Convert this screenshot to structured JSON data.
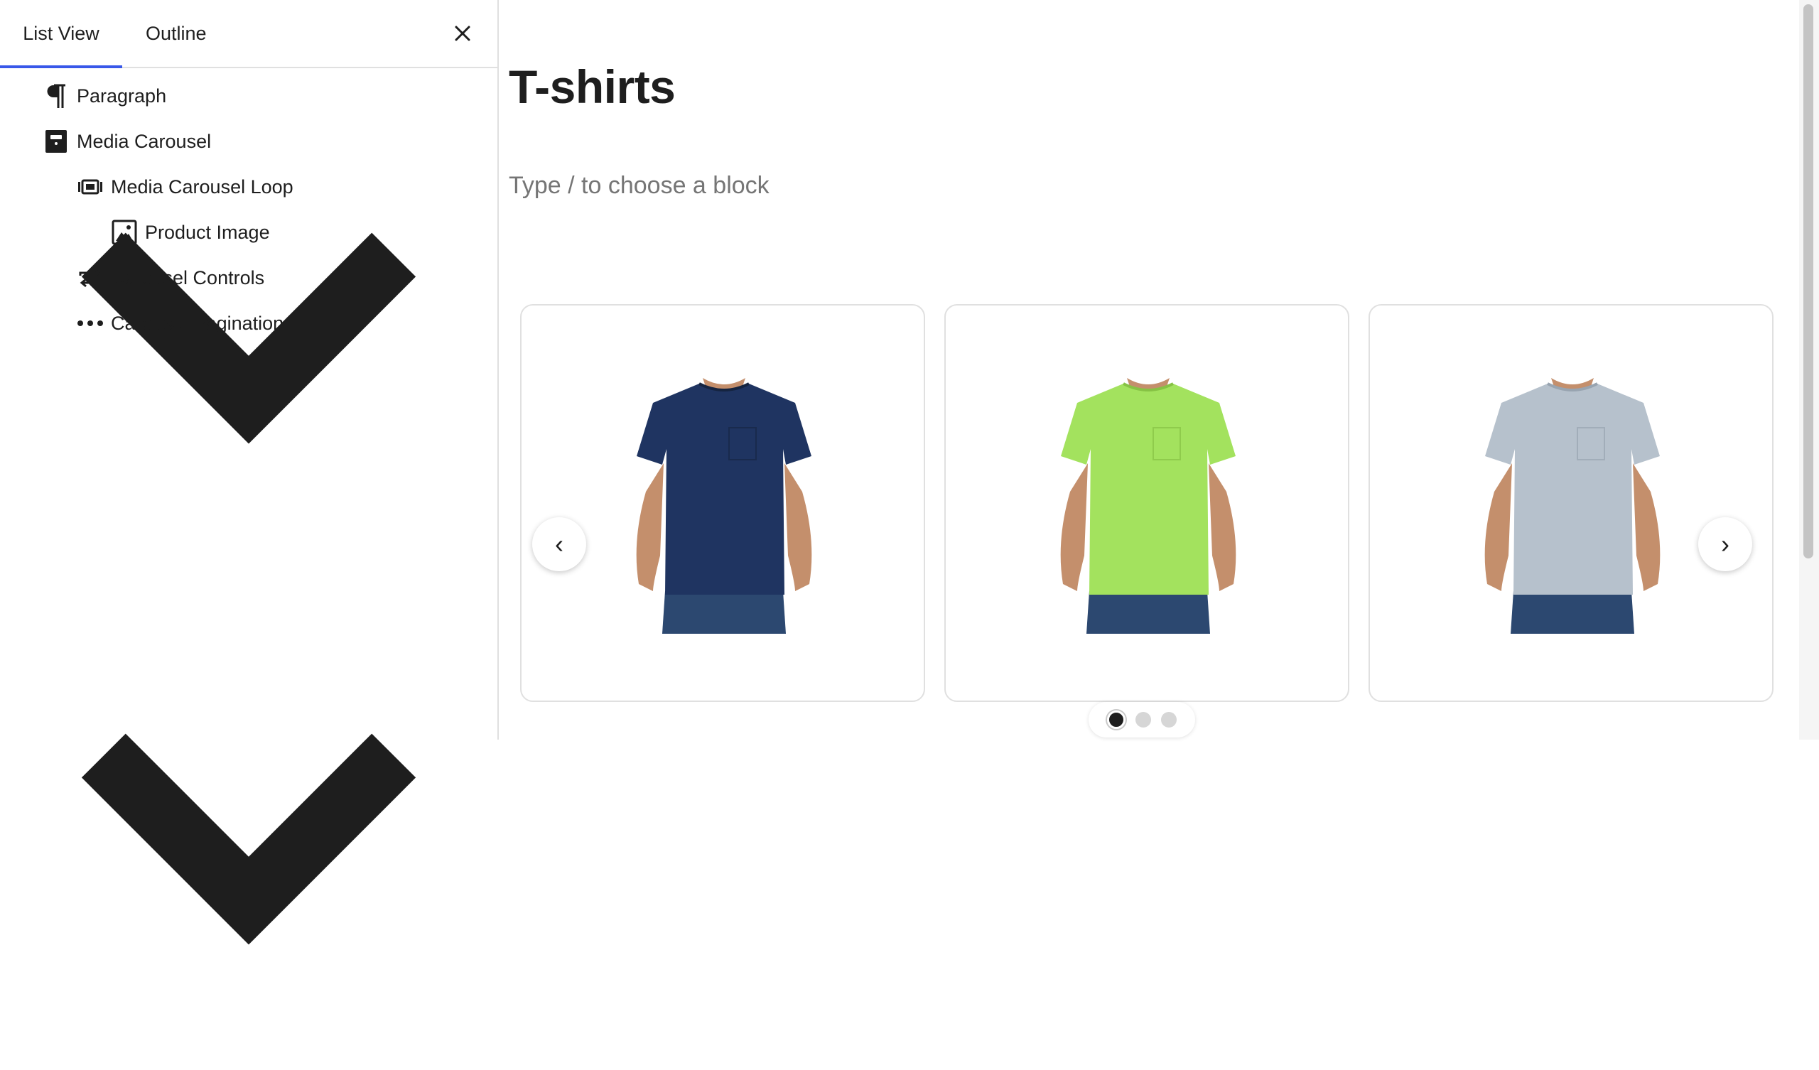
{
  "sidebar": {
    "tabs": [
      {
        "label": "List View",
        "active": true
      },
      {
        "label": "Outline",
        "active": false
      }
    ],
    "close_icon": "close-icon",
    "items": [
      {
        "label": "Paragraph",
        "icon": "paragraph-icon",
        "expanded": null
      },
      {
        "label": "Media Carousel",
        "icon": "media-carousel-icon",
        "expanded": true
      },
      {
        "label": "Media Carousel Loop",
        "icon": "carousel-loop-icon",
        "expanded": true
      },
      {
        "label": "Product Image",
        "icon": "image-icon",
        "expanded": null
      },
      {
        "label": "Carousel Controls",
        "icon": "controls-icon",
        "expanded": null
      },
      {
        "label": "Carousel Pagination",
        "icon": "ellipsis-icon",
        "expanded": null
      }
    ]
  },
  "main": {
    "title": "T-shirts",
    "block_placeholder": "Type / to choose a block",
    "carousel": {
      "slides": [
        {
          "color_name": "navy",
          "shirt_color": "#1f3461"
        },
        {
          "color_name": "lime",
          "shirt_color": "#a3e25e"
        },
        {
          "color_name": "heather-grey",
          "shirt_color": "#b6c1cc"
        }
      ],
      "prev_label": "‹",
      "next_label": "›",
      "pages": 3,
      "active_page": 1
    }
  },
  "colors": {
    "accent": "#3858e9",
    "text": "#1e1e1e",
    "muted": "#757575",
    "border": "#e0e0e0"
  }
}
